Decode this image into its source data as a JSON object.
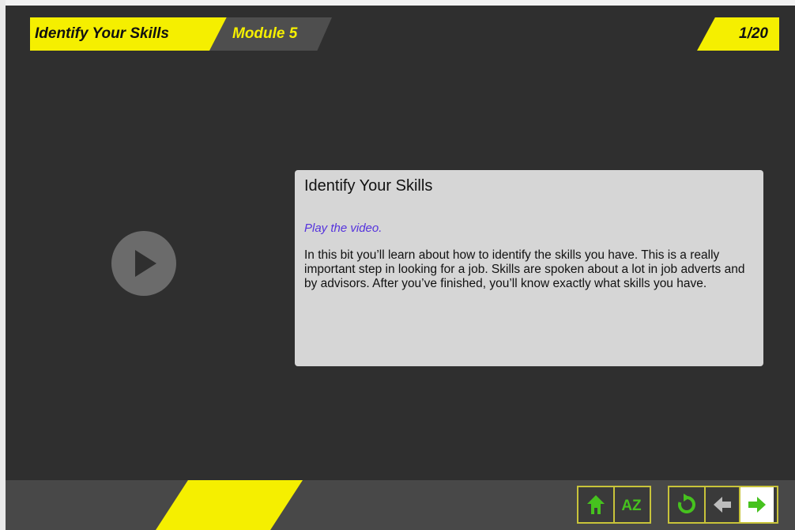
{
  "header": {
    "title": "Identify Your Skills",
    "module": "Module 5",
    "page_counter": "1/20"
  },
  "video": {
    "play_icon": "play-icon"
  },
  "content": {
    "heading": "Identify Your Skills",
    "instruction": "Play the video.",
    "body": "In this bit you’ll learn about how to identify the skills you have. This is a really important step in looking for a job. Skills are spoken about a lot in job adverts and by advisors. After you’ve finished, you’ll know exactly what skills you have."
  },
  "footer": {
    "buttons": [
      {
        "icon": "home-icon"
      },
      {
        "icon": "glossary-az-icon",
        "label": "AZ"
      },
      {
        "icon": "replay-icon"
      },
      {
        "icon": "back-arrow-icon"
      },
      {
        "icon": "next-arrow-icon"
      }
    ]
  },
  "colors": {
    "accent_yellow": "#f5ef00",
    "background": "#2f2f2f",
    "icon_green": "#46c21e",
    "instruction_purple": "#5533dd",
    "panel": "#d6d6d6"
  }
}
